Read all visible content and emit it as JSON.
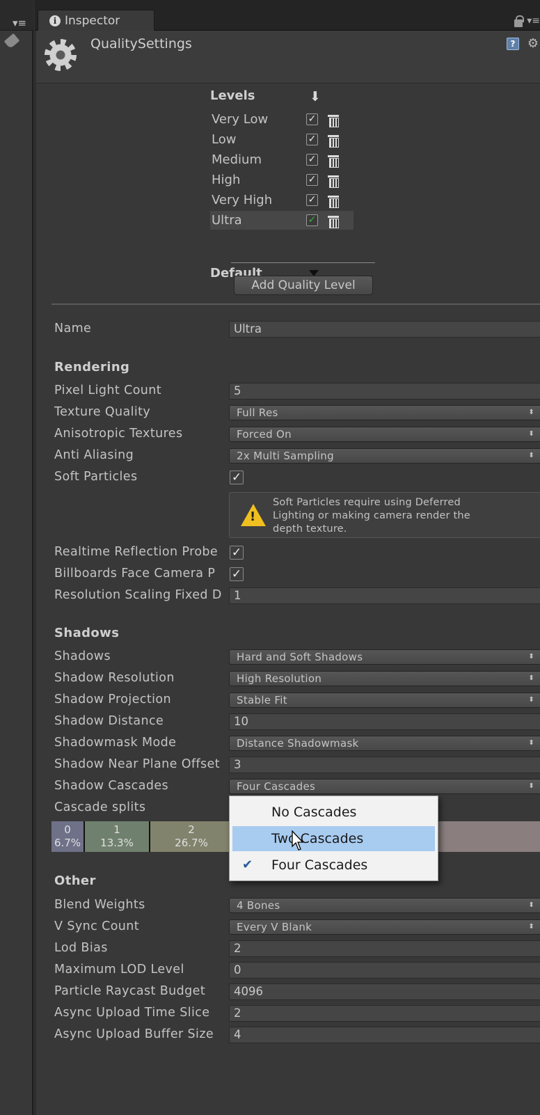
{
  "tab": {
    "title": "Inspector"
  },
  "header": {
    "title": "QualitySettings"
  },
  "levels": {
    "heading": "Levels",
    "items": [
      {
        "name": "Very Low",
        "checked": true
      },
      {
        "name": "Low",
        "checked": true
      },
      {
        "name": "Medium",
        "checked": true
      },
      {
        "name": "High",
        "checked": true
      },
      {
        "name": "Very High",
        "checked": true
      },
      {
        "name": "Ultra",
        "checked": true,
        "selected": true
      }
    ],
    "default_label": "Default",
    "add_button": "Add Quality Level"
  },
  "name_field": {
    "label": "Name",
    "value": "Ultra"
  },
  "rendering": {
    "heading": "Rendering",
    "pixel_light_count": {
      "label": "Pixel Light Count",
      "value": "5"
    },
    "texture_quality": {
      "label": "Texture Quality",
      "value": "Full Res"
    },
    "anisotropic_textures": {
      "label": "Anisotropic Textures",
      "value": "Forced On"
    },
    "anti_aliasing": {
      "label": "Anti Aliasing",
      "value": "2x Multi Sampling"
    },
    "soft_particles": {
      "label": "Soft Particles",
      "checked": true
    },
    "soft_particles_help": "Soft Particles require using Deferred Lighting or making camera render the depth texture.",
    "realtime_reflection": {
      "label": "Realtime Reflection Probe",
      "checked": true
    },
    "billboards": {
      "label": "Billboards Face Camera P",
      "checked": true
    },
    "resolution_scaling": {
      "label": "Resolution Scaling Fixed D",
      "value": "1"
    }
  },
  "shadows": {
    "heading": "Shadows",
    "shadows": {
      "label": "Shadows",
      "value": "Hard and Soft Shadows"
    },
    "resolution": {
      "label": "Shadow Resolution",
      "value": "High Resolution"
    },
    "projection": {
      "label": "Shadow Projection",
      "value": "Stable Fit"
    },
    "distance": {
      "label": "Shadow Distance",
      "value": "10"
    },
    "shadowmask": {
      "label": "Shadowmask Mode",
      "value": "Distance Shadowmask"
    },
    "near_plane": {
      "label": "Shadow Near Plane Offset",
      "value": "3"
    },
    "cascades": {
      "label": "Shadow Cascades",
      "value": "Four Cascades"
    },
    "cascade_splits_label": "Cascade splits",
    "cascade_segments": [
      {
        "index": "0",
        "percent": "6.7%"
      },
      {
        "index": "1",
        "percent": "13.3%"
      },
      {
        "index": "2",
        "percent": "26.7%"
      }
    ],
    "cascade_menu": [
      {
        "label": "No Cascades",
        "checked": false,
        "highlighted": false
      },
      {
        "label": "Two Cascades",
        "checked": false,
        "highlighted": true
      },
      {
        "label": "Four Cascades",
        "checked": true,
        "highlighted": false
      }
    ]
  },
  "other": {
    "heading": "Other",
    "blend_weights": {
      "label": "Blend Weights",
      "value": "4 Bones"
    },
    "vsync": {
      "label": "V Sync Count",
      "value": "Every V Blank"
    },
    "lod_bias": {
      "label": "Lod Bias",
      "value": "2"
    },
    "max_lod": {
      "label": "Maximum LOD Level",
      "value": "0"
    },
    "raycast_budget": {
      "label": "Particle Raycast Budget",
      "value": "4096"
    },
    "async_time_slice": {
      "label": "Async Upload Time Slice",
      "value": "2"
    },
    "async_buffer": {
      "label": "Async Upload Buffer Size",
      "value": "4"
    }
  }
}
